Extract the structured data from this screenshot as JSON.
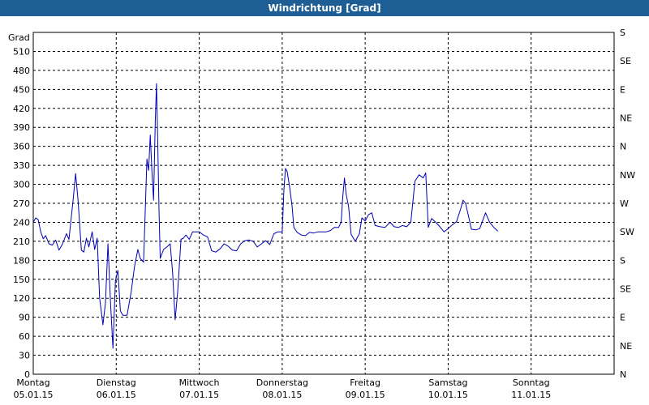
{
  "window": {
    "title": "Windrichtung [Grad]"
  },
  "chart_data": {
    "type": "line",
    "title": "Windrichtung [Grad]",
    "ylabel": "Grad",
    "ylim": [
      0,
      540
    ],
    "yticks": [
      0,
      30,
      60,
      90,
      120,
      150,
      180,
      210,
      240,
      270,
      300,
      330,
      360,
      390,
      420,
      450,
      480,
      510
    ],
    "right_axis_labels": [
      "N",
      "NE",
      "E",
      "SE",
      "S",
      "SW",
      "W",
      "NW",
      "N",
      "NE",
      "E",
      "SE",
      "S"
    ],
    "xlim": [
      0,
      7
    ],
    "xticks": [
      {
        "day": "Montag",
        "date": "05.01.15"
      },
      {
        "day": "Dienstag",
        "date": "06.01.15"
      },
      {
        "day": "Mittwoch",
        "date": "07.01.15"
      },
      {
        "day": "Donnerstag",
        "date": "08.01.15"
      },
      {
        "day": "Freitag",
        "date": "09.01.15"
      },
      {
        "day": "Samstag",
        "date": "10.01.15"
      },
      {
        "day": "Sonntag",
        "date": "11.01.15"
      }
    ],
    "grid": true,
    "line_color": "#0000b4",
    "series": [
      {
        "points": [
          [
            0.0,
            240
          ],
          [
            0.03,
            247
          ],
          [
            0.06,
            244
          ],
          [
            0.09,
            225
          ],
          [
            0.12,
            214
          ],
          [
            0.15,
            219
          ],
          [
            0.19,
            206
          ],
          [
            0.23,
            204
          ],
          [
            0.27,
            212
          ],
          [
            0.31,
            196
          ],
          [
            0.35,
            205
          ],
          [
            0.4,
            222
          ],
          [
            0.43,
            213
          ],
          [
            0.48,
            275
          ],
          [
            0.51,
            317
          ],
          [
            0.54,
            275
          ],
          [
            0.58,
            196
          ],
          [
            0.61,
            193
          ],
          [
            0.64,
            215
          ],
          [
            0.67,
            201
          ],
          [
            0.71,
            225
          ],
          [
            0.74,
            197
          ],
          [
            0.77,
            215
          ],
          [
            0.8,
            120
          ],
          [
            0.84,
            78
          ],
          [
            0.87,
            113
          ],
          [
            0.9,
            206
          ],
          [
            0.93,
            117
          ],
          [
            0.96,
            41
          ],
          [
            0.99,
            148
          ],
          [
            1.02,
            164
          ],
          [
            1.05,
            100
          ],
          [
            1.08,
            93
          ],
          [
            1.13,
            93
          ],
          [
            1.18,
            130
          ],
          [
            1.22,
            170
          ],
          [
            1.26,
            197
          ],
          [
            1.29,
            183
          ],
          [
            1.33,
            177
          ],
          [
            1.37,
            340
          ],
          [
            1.39,
            322
          ],
          [
            1.41,
            378
          ],
          [
            1.43,
            320
          ],
          [
            1.45,
            275
          ],
          [
            1.47,
            400
          ],
          [
            1.485,
            459
          ],
          [
            1.5,
            370
          ],
          [
            1.515,
            260
          ],
          [
            1.53,
            183
          ],
          [
            1.57,
            197
          ],
          [
            1.61,
            201
          ],
          [
            1.65,
            206
          ],
          [
            1.68,
            160
          ],
          [
            1.71,
            86
          ],
          [
            1.74,
            130
          ],
          [
            1.78,
            213
          ],
          [
            1.81,
            215
          ],
          [
            1.84,
            220
          ],
          [
            1.88,
            213
          ],
          [
            1.92,
            225
          ],
          [
            2.0,
            225
          ],
          [
            2.05,
            220
          ],
          [
            2.1,
            217
          ],
          [
            2.15,
            195
          ],
          [
            2.2,
            193
          ],
          [
            2.25,
            198
          ],
          [
            2.3,
            206
          ],
          [
            2.35,
            202
          ],
          [
            2.4,
            196
          ],
          [
            2.45,
            195
          ],
          [
            2.5,
            206
          ],
          [
            2.55,
            211
          ],
          [
            2.6,
            212
          ],
          [
            2.65,
            210
          ],
          [
            2.7,
            201
          ],
          [
            2.75,
            206
          ],
          [
            2.8,
            211
          ],
          [
            2.85,
            205
          ],
          [
            2.9,
            222
          ],
          [
            2.95,
            225
          ],
          [
            3.0,
            225
          ],
          [
            3.02,
            290
          ],
          [
            3.04,
            325
          ],
          [
            3.06,
            320
          ],
          [
            3.09,
            295
          ],
          [
            3.12,
            265
          ],
          [
            3.14,
            232
          ],
          [
            3.18,
            224
          ],
          [
            3.23,
            220
          ],
          [
            3.28,
            219
          ],
          [
            3.33,
            224
          ],
          [
            3.38,
            223
          ],
          [
            3.43,
            225
          ],
          [
            3.48,
            225
          ],
          [
            3.53,
            225
          ],
          [
            3.58,
            227
          ],
          [
            3.63,
            232
          ],
          [
            3.68,
            232
          ],
          [
            3.71,
            240
          ],
          [
            3.73,
            280
          ],
          [
            3.75,
            310
          ],
          [
            3.77,
            285
          ],
          [
            3.8,
            265
          ],
          [
            3.83,
            221
          ],
          [
            3.88,
            210
          ],
          [
            3.93,
            222
          ],
          [
            3.96,
            247
          ],
          [
            4.0,
            242
          ],
          [
            4.04,
            252
          ],
          [
            4.08,
            255
          ],
          [
            4.12,
            235
          ],
          [
            4.18,
            233
          ],
          [
            4.24,
            232
          ],
          [
            4.3,
            240
          ],
          [
            4.35,
            233
          ],
          [
            4.4,
            232
          ],
          [
            4.45,
            235
          ],
          [
            4.5,
            233
          ],
          [
            4.55,
            240
          ],
          [
            4.6,
            305
          ],
          [
            4.65,
            315
          ],
          [
            4.7,
            310
          ],
          [
            4.73,
            318
          ],
          [
            4.76,
            232
          ],
          [
            4.8,
            246
          ],
          [
            4.85,
            240
          ],
          [
            4.9,
            233
          ],
          [
            4.95,
            225
          ],
          [
            5.0,
            230
          ],
          [
            5.05,
            236
          ],
          [
            5.1,
            241
          ],
          [
            5.15,
            261
          ],
          [
            5.18,
            275
          ],
          [
            5.21,
            270
          ],
          [
            5.25,
            247
          ],
          [
            5.28,
            229
          ],
          [
            5.33,
            228
          ],
          [
            5.38,
            230
          ],
          [
            5.45,
            255
          ],
          [
            5.5,
            240
          ],
          [
            5.55,
            232
          ],
          [
            5.6,
            226
          ]
        ]
      }
    ]
  }
}
